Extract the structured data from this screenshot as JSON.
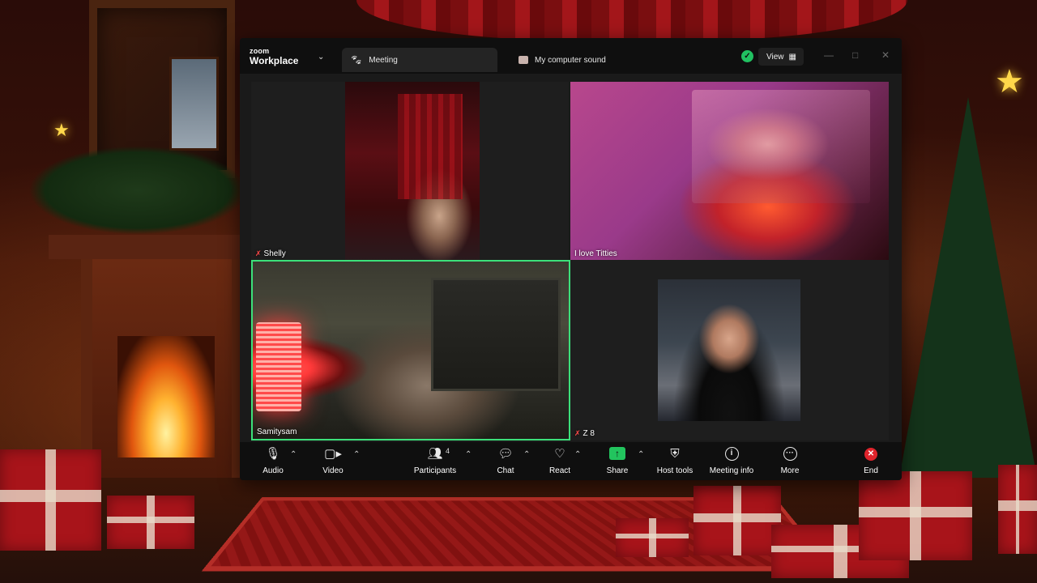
{
  "app": {
    "brand_small": "zoom",
    "brand_large": "Workplace"
  },
  "tabs": [
    {
      "label": "Meeting",
      "icon": "paw-icon",
      "active": true
    },
    {
      "label": "My computer sound",
      "icon": "computer-sound-icon",
      "active": false
    }
  ],
  "header": {
    "view_label": "View",
    "secure_icon": "shield-check-icon",
    "accent": "#21c161"
  },
  "participants": [
    {
      "name": "Shelly",
      "muted": true,
      "active_speaker": false
    },
    {
      "name": "I love Titties",
      "muted": false,
      "active_speaker": false
    },
    {
      "name": "Samitysam",
      "muted": false,
      "active_speaker": true
    },
    {
      "name": "Z 8",
      "muted": true,
      "active_speaker": false
    }
  ],
  "toolbar": {
    "audio": "Audio",
    "video": "Video",
    "participants": "Participants",
    "participant_count": "4",
    "chat": "Chat",
    "react": "React",
    "share": "Share",
    "host_tools": "Host tools",
    "meeting_info": "Meeting info",
    "more": "More",
    "end": "End",
    "end_color": "#e0242c",
    "share_color": "#22c45e",
    "speaker_border_color": "#3ce07a"
  }
}
